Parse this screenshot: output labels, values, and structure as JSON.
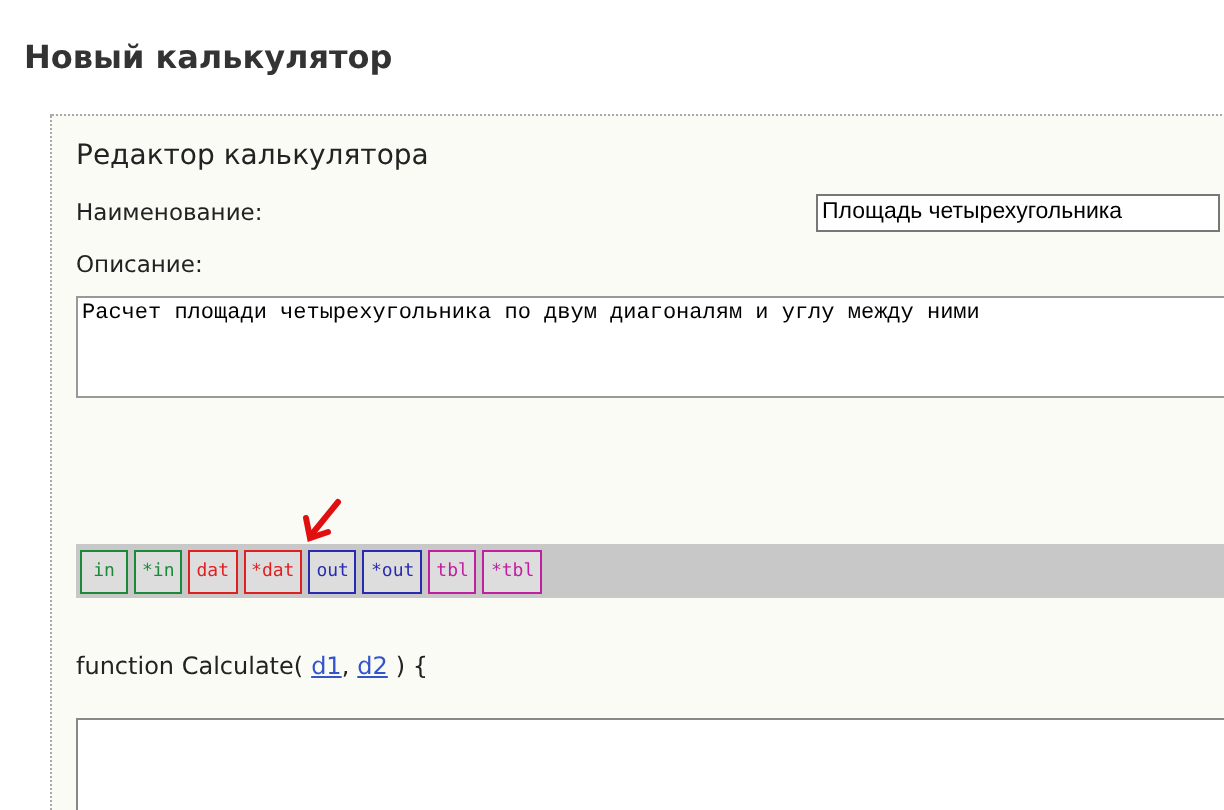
{
  "page_title": "Новый калькулятор",
  "editor": {
    "heading": "Редактор калькулятора",
    "name_label": "Наименование:",
    "name_value": "Площадь четырехугольника",
    "description_label": "Описание:",
    "description_value": "Расчет площади четырехугольника по двум диагоналям и углу между ними",
    "toolbar": [
      {
        "label": "in",
        "color": "#1a8a3a"
      },
      {
        "label": "*in",
        "color": "#1a8a3a"
      },
      {
        "label": "dat",
        "color": "#e02020"
      },
      {
        "label": "*dat",
        "color": "#e02020"
      },
      {
        "label": "out",
        "color": "#2a2ab0"
      },
      {
        "label": "*out",
        "color": "#2a2ab0"
      },
      {
        "label": "tbl",
        "color": "#c020a0"
      },
      {
        "label": "*tbl",
        "color": "#c020a0"
      }
    ],
    "function_prefix": "function Calculate(",
    "params": [
      "d1",
      "d2"
    ],
    "param_separator": ",",
    "function_suffix": ") {"
  }
}
